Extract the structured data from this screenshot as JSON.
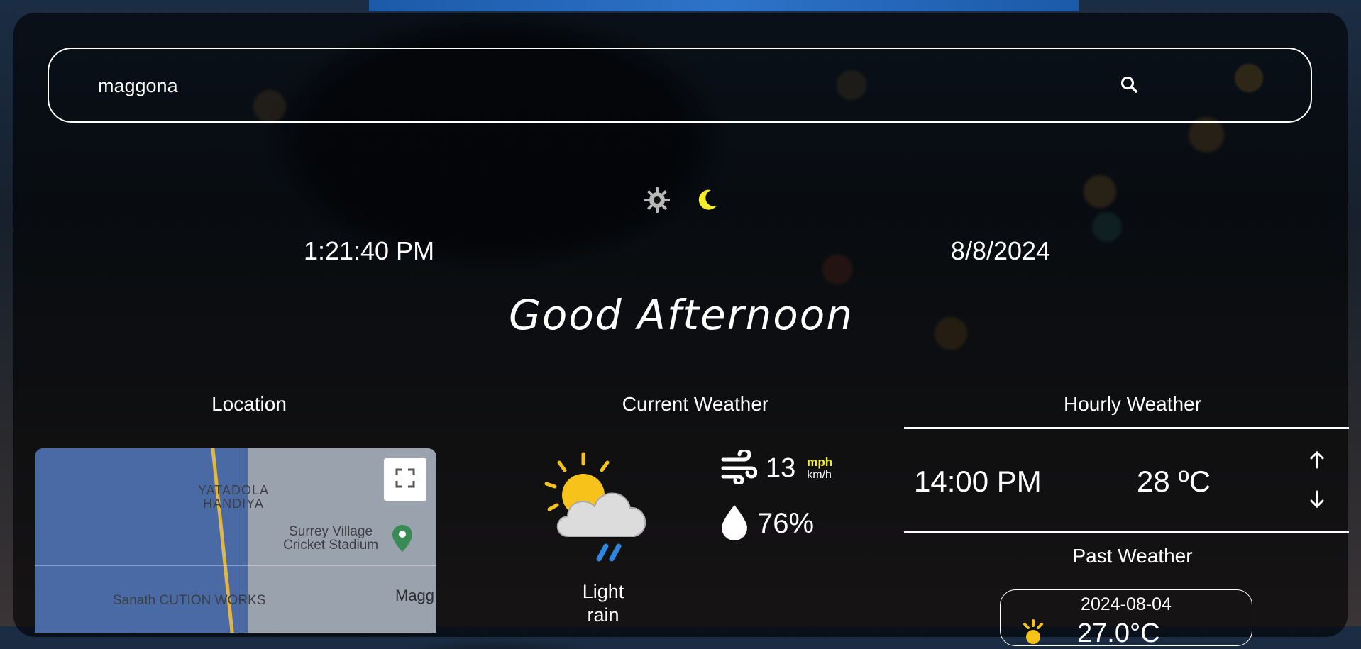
{
  "search": {
    "value": "maggona"
  },
  "icons": {
    "search": "search-icon",
    "theme_light": "sun-icon",
    "theme_dark": "moon-icon",
    "fullscreen": "fullscreen-icon",
    "wind": "wind-icon",
    "humidity": "droplet-icon",
    "weather": "partly-cloudy-light-rain-icon"
  },
  "colors": {
    "accent": "#f3ec2a",
    "rain": "#2e86de",
    "sun": "#f7c31a"
  },
  "time": "1:21:40 PM",
  "date": "8/8/2024",
  "greeting": "Good Afternoon",
  "location": {
    "heading": "Location",
    "map_labels": {
      "area": "YATADOLA\nHANDIYA",
      "stadium_line1": "Surrey Village",
      "stadium_line2": "Cricket Stadium",
      "business": "Sanath CUTION WORKS",
      "town": "Magg"
    }
  },
  "current": {
    "heading": "Current Weather",
    "condition_line1": "Light",
    "condition_line2": "rain",
    "wind_speed": "13",
    "unit_primary": "mph",
    "unit_secondary": "km/h",
    "humidity": "76%"
  },
  "hourly": {
    "heading": "Hourly Weather",
    "time": "14:00 PM",
    "temp": "28 ºC"
  },
  "past": {
    "heading": "Past Weather",
    "date": "2024-08-04",
    "temp": "27.0°C"
  }
}
